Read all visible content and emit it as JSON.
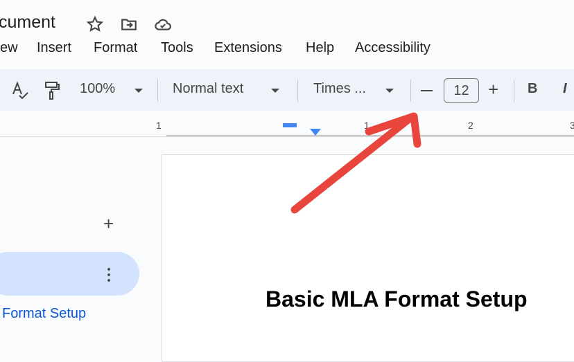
{
  "doc": {
    "title": "cument"
  },
  "menu": [
    "ew",
    "Insert",
    "Format",
    "Tools",
    "Extensions",
    "Help",
    "Accessibility"
  ],
  "toolbar": {
    "zoom": "100%",
    "style": "Normal text",
    "font": "Times ...",
    "font_size": "12",
    "bold": "B",
    "italic": "I"
  },
  "ruler": {
    "labels": [
      "1",
      "1",
      "2",
      "3"
    ]
  },
  "outline": {
    "add": "+",
    "item": "Format Setup"
  },
  "page": {
    "heading": "Basic MLA Format Setup"
  },
  "colors": {
    "accent": "#0b57d0",
    "arrow": "#e8453c",
    "highlight": "#d3e3fd"
  }
}
